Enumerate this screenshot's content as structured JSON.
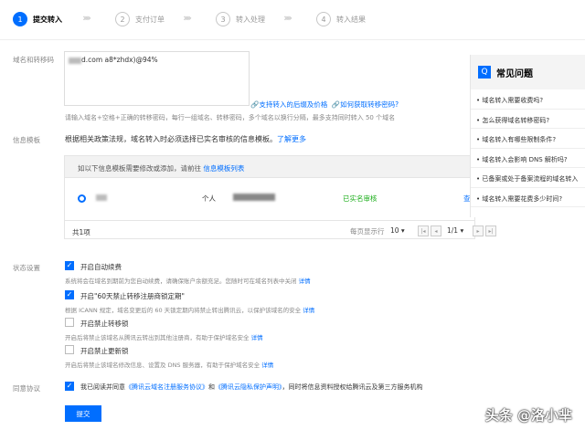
{
  "steps": [
    {
      "num": "1",
      "label": "提交转入"
    },
    {
      "num": "2",
      "label": "支付订单"
    },
    {
      "num": "3",
      "label": "转入处理"
    },
    {
      "num": "4",
      "label": "转入结果"
    }
  ],
  "domain_section": {
    "label": "域名和转移码",
    "textarea_value": "d.com a8*zhdx)@94%",
    "link_price": "支持转入的后缀及价格",
    "link_code": "如何获取转移密码?",
    "hint": "请输入域名+空格+正确的转移密码，每行一组域名、转移密码，多个域名以换行分隔，最多支持同时转入 50 个域名"
  },
  "template_section": {
    "label": "信息模板",
    "desc": "根据相关政策法规，域名转入时必须选择已实名审核的信息模板。",
    "learn_more": "了解更多",
    "notice": "如以下信息模板需要修改或添加，请前往",
    "notice_link": "信息模板列表",
    "row": {
      "type": "个人",
      "status": "已实名审核",
      "action": "查"
    },
    "total": "共1项",
    "per_page_label": "每页显示行",
    "per_page": "10",
    "page": "1/1"
  },
  "status_section": {
    "label": "状态设置",
    "options": [
      {
        "title": "开启自动续费",
        "desc": "系统将会在域名到期前为您自动续费，请确保账户余额充足。您随时可在域名列表中关闭",
        "link": "详情",
        "checked": true
      },
      {
        "title": "开启\"60天禁止转移注册商锁定期\"",
        "desc": "根据 ICANN 规定，域名变更后的 60 天锁定期内将禁止转出腾讯云，以保护该域名的安全",
        "link": "详情",
        "checked": true
      },
      {
        "title": "开启禁止转移锁",
        "desc": "开启后将禁止该域名从腾讯云转出到其他注册商，有助于保护域名安全",
        "link": "详情",
        "checked": false
      },
      {
        "title": "开启禁止更新锁",
        "desc": "开启后将禁止该域名修改信息、设置及 DNS 服务器，有助于保护域名安全",
        "link": "详情",
        "checked": false
      }
    ]
  },
  "agreement": {
    "label": "同意协议",
    "text_pre": "我已阅读并同意",
    "link1": "《腾讯云域名注册服务协议》",
    "and": "和",
    "link2": "《腾讯云隐私保护声明》",
    "text_post": "，同时将信息资料授权给腾讯云及第三方服务机构"
  },
  "submit_label": "提交",
  "faq": {
    "title": "常见问题",
    "items": [
      "域名转入需要收费吗?",
      "怎么获得域名转移密码?",
      "域名转入有哪些限制条件?",
      "域名转入会影响 DNS 解析吗?",
      "已备案或处于备案流程的域名转入",
      "域名转入需要花费多少时间?"
    ]
  },
  "watermark": "头条 @洛小芈",
  "colors": {
    "primary": "#006eff",
    "status_green": "#1aad19"
  }
}
